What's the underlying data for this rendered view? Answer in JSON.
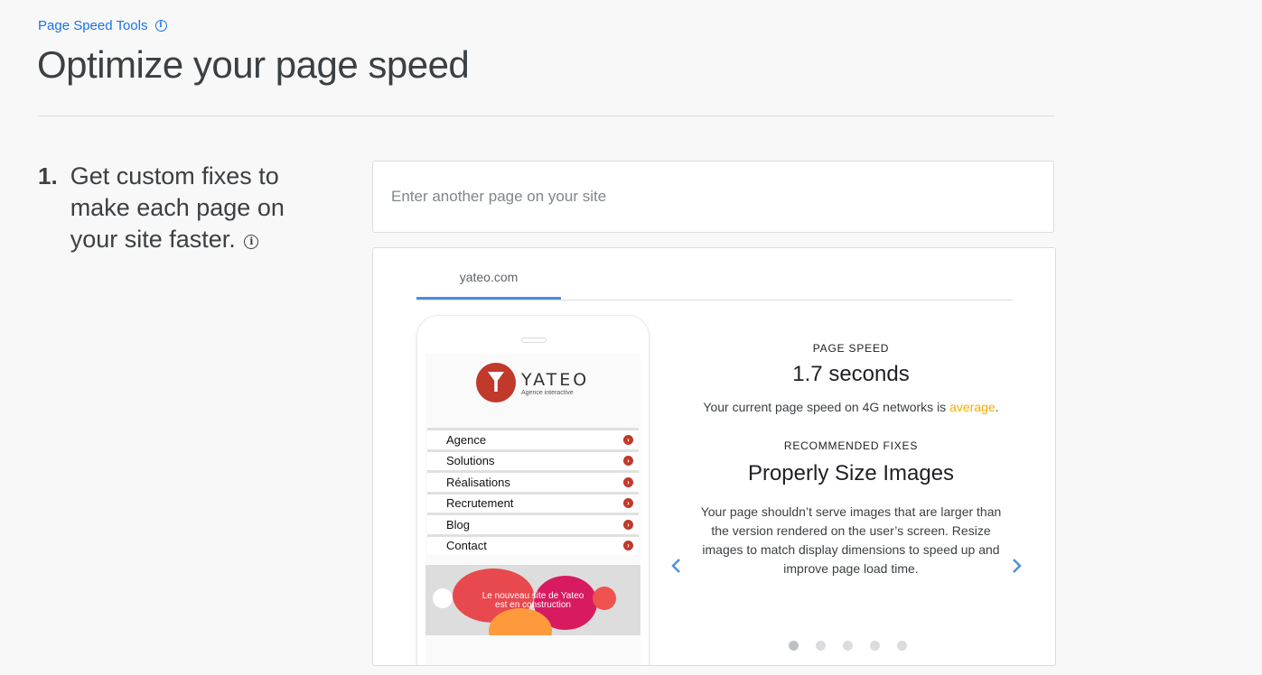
{
  "breadcrumb": {
    "label": "Page Speed Tools"
  },
  "page": {
    "title": "Optimize your page speed"
  },
  "step": {
    "number": "1.",
    "text": "Get custom fixes to make each page on your site faster."
  },
  "search": {
    "placeholder": "Enter another page on your site",
    "value": ""
  },
  "tabs": [
    {
      "label": "yateo.com"
    }
  ],
  "phone_preview": {
    "logo_name": "YATEO",
    "logo_tagline": "Agence interactive",
    "menu": [
      "Agence",
      "Solutions",
      "Réalisations",
      "Recrutement",
      "Blog",
      "Contact"
    ],
    "banner_text": [
      "Le nouveau site de Yateo",
      "est en construction"
    ]
  },
  "result": {
    "speed_label": "PAGE SPEED",
    "speed_value": "1.7 seconds",
    "speed_desc_prefix": "Your current page speed on 4G networks is ",
    "speed_rating": "average",
    "speed_desc_suffix": ".",
    "fixes_label": "RECOMMENDED FIXES",
    "fix_title": "Properly Size Images",
    "fix_desc": "Your page shouldn’t serve images that are larger than the version rendered on the user’s screen. Resize images to match display dimensions to speed up and improve page load time."
  },
  "carousel": {
    "total": 5,
    "active_index": 0
  },
  "icons": {
    "prev": "chevron-left-icon",
    "next": "chevron-right-icon",
    "info": "info-icon"
  },
  "colors": {
    "accent": "#1a73e8",
    "rating_average": "#f9ab00",
    "logo_red": "#c0392b"
  }
}
